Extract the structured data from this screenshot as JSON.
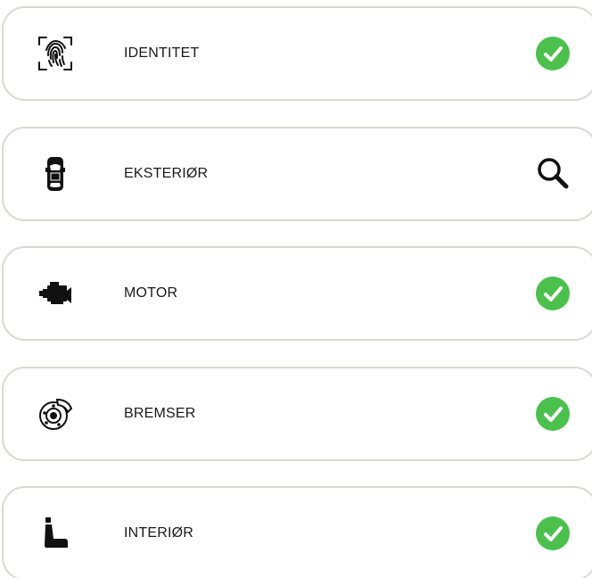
{
  "colors": {
    "success": "#4cc04c",
    "card_border": "#d9d9d4",
    "text": "#1a1a1a"
  },
  "items": [
    {
      "label": "IDENTITET",
      "icon": "fingerprint-icon",
      "status": "check-icon"
    },
    {
      "label": "EKSTERIØR",
      "icon": "car-top-view-icon",
      "status": "search-icon"
    },
    {
      "label": "MOTOR",
      "icon": "engine-icon",
      "status": "check-icon"
    },
    {
      "label": "BREMSER",
      "icon": "brake-disc-icon",
      "status": "check-icon"
    },
    {
      "label": "INTERIØR",
      "icon": "car-seat-icon",
      "status": "check-icon"
    }
  ]
}
